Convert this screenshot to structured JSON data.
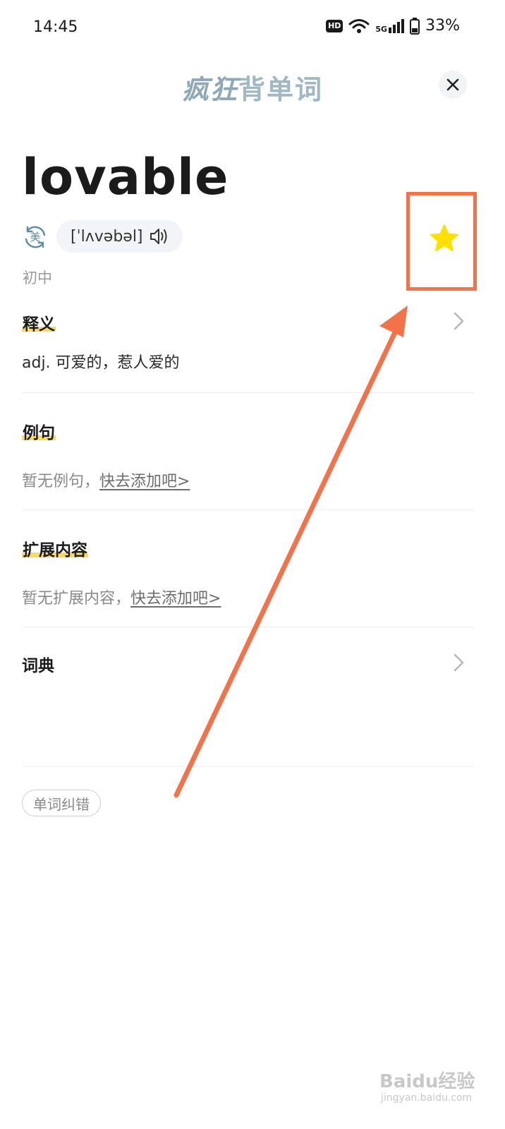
{
  "status_bar": {
    "time": "14:45",
    "hd": "HD",
    "network": "5G",
    "battery": "33%"
  },
  "header": {
    "logo_part1": "疯狂",
    "logo_part2": "背单词"
  },
  "word": {
    "text": "lovable",
    "accent": "美",
    "phonetic": "[ˈlʌvəbəl]",
    "level": "初中"
  },
  "sections": {
    "definition": {
      "title": "释义",
      "content": "adj. 可爱的，惹人爱的"
    },
    "examples": {
      "title": "例句",
      "empty": "暂无例句，",
      "add_link": "快去添加吧>"
    },
    "extended": {
      "title": "扩展内容",
      "empty": "暂无扩展内容，",
      "add_link": "快去添加吧>"
    },
    "dictionary": {
      "title": "词典"
    }
  },
  "report_button": "单词纠错",
  "colors": {
    "accent_yellow": "#f9dc5c",
    "star": "#ffe000",
    "annotation": "#f2734a",
    "logo": "#9fb8c2"
  },
  "watermark": {
    "brand": "Baidu经验",
    "url": "jingyan.baidu.com"
  }
}
